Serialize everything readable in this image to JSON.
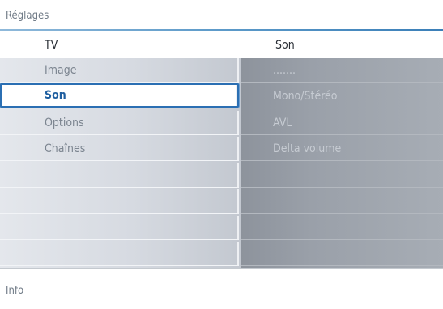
{
  "title": "Réglages",
  "header": {
    "left_label": "TV",
    "right_label": "Son"
  },
  "left_menu": {
    "items": [
      {
        "label": "Image",
        "selected": false
      },
      {
        "label": "Son",
        "selected": true
      },
      {
        "label": "Options",
        "selected": false
      },
      {
        "label": "Chaînes",
        "selected": false
      },
      {
        "label": "",
        "selected": false
      },
      {
        "label": "",
        "selected": false
      },
      {
        "label": "",
        "selected": false
      },
      {
        "label": "",
        "selected": false
      }
    ]
  },
  "right_menu": {
    "items": [
      {
        "label": "......."
      },
      {
        "label": "Mono/Stéréo"
      },
      {
        "label": "AVL"
      },
      {
        "label": "Delta volume"
      },
      {
        "label": ""
      },
      {
        "label": ""
      },
      {
        "label": ""
      },
      {
        "label": ""
      }
    ]
  },
  "info": {
    "label": "Info"
  },
  "colors": {
    "accent": "#2b6fb3",
    "title_rule": "#5c9ac9",
    "left_panel": "#d6dae1",
    "right_panel": "#9aa0a9"
  }
}
